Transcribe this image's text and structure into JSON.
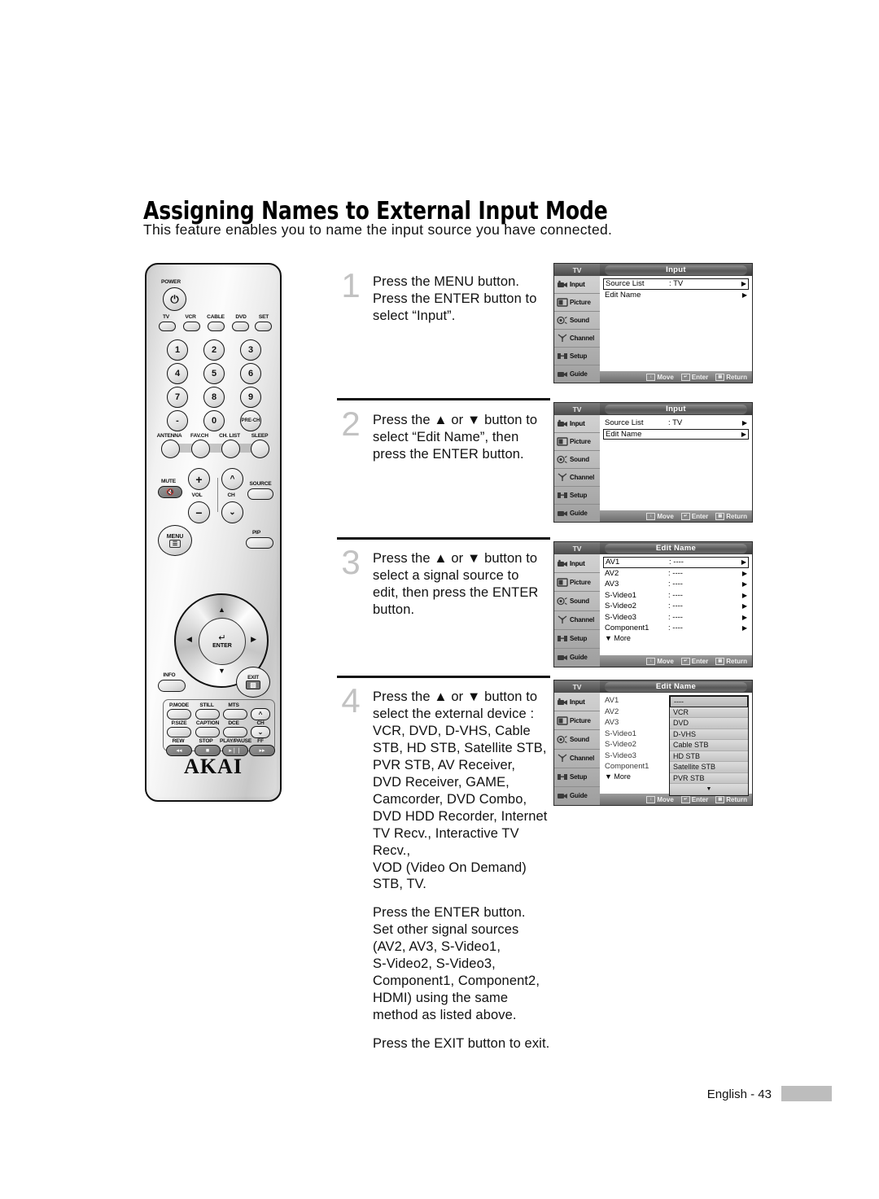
{
  "page": {
    "title": "Assigning Names to External Input Mode",
    "intro": "This feature enables you to name the input source you have connected.",
    "footer": "English - 43"
  },
  "remote": {
    "brand": "AKAI",
    "power_label": "POWER",
    "device_buttons": [
      "TV",
      "VCR",
      "CABLE",
      "DVD",
      "SET"
    ],
    "keypad": [
      "1",
      "2",
      "3",
      "4",
      "5",
      "6",
      "7",
      "8",
      "9",
      "-",
      "0",
      "PRE-CH"
    ],
    "function_row": [
      "ANTENNA",
      "FAV.CH",
      "CH. LIST",
      "SLEEP"
    ],
    "mute_label": "MUTE",
    "vol_label": "VOL",
    "ch_label": "CH",
    "source_label": "SOURCE",
    "menu_label": "MENU",
    "pip_label": "PIP",
    "enter_label": "ENTER",
    "info_label": "INFO",
    "exit_label": "EXIT",
    "plus": "+",
    "minus": "−",
    "bottom_labels_row1": [
      "P.MODE",
      "STILL",
      "MTS"
    ],
    "bottom_labels_row2": [
      "P.SIZE",
      "CAPTION",
      "DCE"
    ],
    "bottom_labels_row3": [
      "REW",
      "STOP",
      "PLAY/PAUSE",
      "FF"
    ],
    "ch_up_label": "CH",
    "transport": [
      "◂◂",
      "■",
      "▸❘❘",
      "▸▸"
    ]
  },
  "steps": [
    {
      "number": "1",
      "lines": [
        "Press the MENU button.\nPress the ENTER button to\nselect “Input”."
      ]
    },
    {
      "number": "2",
      "lines": [
        "Press the ▲ or ▼ button to\nselect “Edit Name”, then\npress the ENTER button."
      ]
    },
    {
      "number": "3",
      "lines": [
        "Press the ▲ or ▼ button to\nselect a signal source to\nedit, then press the ENTER\nbutton."
      ]
    },
    {
      "number": "4",
      "lines": [
        "Press the ▲ or ▼ button to\nselect the external device :\nVCR, DVD, D-VHS, Cable\nSTB, HD STB, Satellite STB,\nPVR STB, AV Receiver,\nDVD Receiver, GAME,\nCamcorder, DVD Combo,\nDVD HDD Recorder, Internet\nTV Recv., Interactive TV Recv.,\nVOD (Video On Demand) STB, TV.",
        "Press the ENTER button.\nSet other signal sources\n(AV2, AV3, S-Video1,\nS-Video2, S-Video3,\nComponent1, Component2,\nHDMI) using the same\nmethod as listed above.",
        "Press the EXIT button to exit."
      ]
    }
  ],
  "osd": {
    "tv_label": "TV",
    "sidebar": [
      {
        "label": "Input",
        "icon": "camcorder-icon"
      },
      {
        "label": "Picture",
        "icon": "picture-icon"
      },
      {
        "label": "Sound",
        "icon": "speaker-icon"
      },
      {
        "label": "Channel",
        "icon": "antenna-icon"
      },
      {
        "label": "Setup",
        "icon": "setup-icon"
      },
      {
        "label": "Guide",
        "icon": "guide-icon"
      }
    ],
    "hints": {
      "move": "Move",
      "enter": "Enter",
      "return": "Return"
    },
    "panels": [
      {
        "title": "Input",
        "rows": [
          {
            "name": "Source List",
            "value": ": TV",
            "arrow": "▶",
            "selected": true
          },
          {
            "name": "Edit Name",
            "value": "",
            "arrow": "▶",
            "selected": false
          }
        ]
      },
      {
        "title": "Input",
        "rows": [
          {
            "name": "Source List",
            "value": ": TV",
            "arrow": "▶",
            "selected": false
          },
          {
            "name": "Edit Name",
            "value": "",
            "arrow": "▶",
            "selected": true
          }
        ]
      },
      {
        "title": "Edit Name",
        "more_label": "▼ More",
        "rows": [
          {
            "name": "AV1",
            "value": ": ----",
            "arrow": "▶",
            "selected": true
          },
          {
            "name": "AV2",
            "value": ": ----",
            "arrow": "▶",
            "selected": false
          },
          {
            "name": "AV3",
            "value": ": ----",
            "arrow": "▶",
            "selected": false
          },
          {
            "name": "S-Video1",
            "value": ": ----",
            "arrow": "▶",
            "selected": false
          },
          {
            "name": "S-Video2",
            "value": ": ----",
            "arrow": "▶",
            "selected": false
          },
          {
            "name": "S-Video3",
            "value": ": ----",
            "arrow": "▶",
            "selected": false
          },
          {
            "name": "Component1",
            "value": ": ----",
            "arrow": "▶",
            "selected": false
          }
        ]
      },
      {
        "title": "Edit Name",
        "more_label": "▼ More",
        "rows": [
          {
            "name": "AV1",
            "value": "",
            "arrow": "",
            "selected": false
          },
          {
            "name": "AV2",
            "value": "",
            "arrow": "",
            "selected": false
          },
          {
            "name": "AV3",
            "value": "",
            "arrow": "",
            "selected": false
          },
          {
            "name": "S-Video1",
            "value": "",
            "arrow": "",
            "selected": false
          },
          {
            "name": "S-Video2",
            "value": "",
            "arrow": "",
            "selected": false
          },
          {
            "name": "S-Video3",
            "value": "",
            "arrow": "",
            "selected": false
          },
          {
            "name": "Component1",
            "value": "",
            "arrow": "",
            "selected": false
          }
        ],
        "dropdown": {
          "items": [
            "----",
            "VCR",
            "DVD",
            "D-VHS",
            "Cable STB",
            "HD STB",
            "Satellite STB",
            "PVR STB"
          ],
          "selected_index": 0,
          "scroll_arrow": "▼"
        }
      }
    ]
  }
}
